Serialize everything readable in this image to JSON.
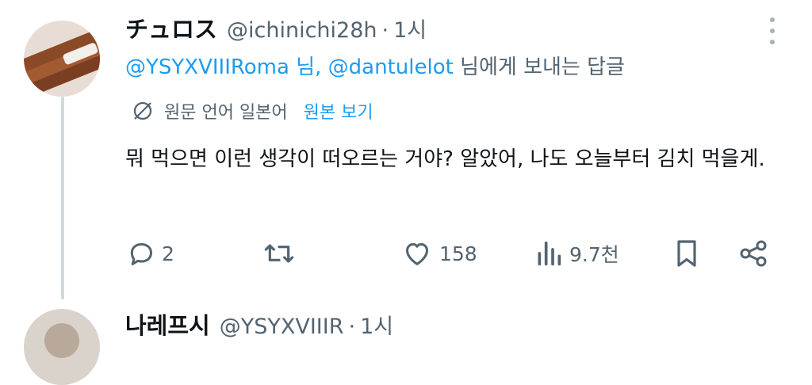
{
  "tweet": {
    "author_name": "チュロス",
    "author_handle": "@ichinichi28h",
    "separator": "·",
    "time": "1시",
    "replying_mention_1": "@YSYXVIIIRoma 님",
    "replying_comma": ", ",
    "replying_mention_2": "@dantulelot",
    "replying_suffix": " 님에게 보내는 답글",
    "translate_label": "원문 언어 일본어",
    "translate_view": "원본 보기",
    "text": "뭐 먹으면 이런 생각이 떠오르는 거야? 알았어, 나도 오늘부터 김치 먹을게.",
    "actions": {
      "reply_count": "2",
      "retweet_count": "",
      "like_count": "158",
      "views_count": "9.7천"
    }
  },
  "next_tweet": {
    "author_name": "나레프시",
    "author_handle": "@YSYXVIIIR",
    "separator": "·",
    "time": "1시"
  },
  "colors": {
    "link": "#1d9bf0",
    "secondary_text": "#536471",
    "thread_line": "#cfd9de"
  },
  "icons": [
    "more-vertical-icon",
    "translate-icon",
    "reply-icon",
    "retweet-icon",
    "like-icon",
    "views-icon",
    "bookmark-icon",
    "share-icon"
  ]
}
